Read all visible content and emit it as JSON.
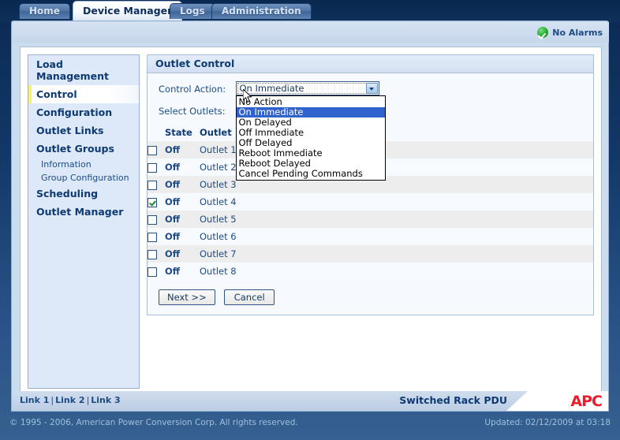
{
  "tabs": [
    {
      "label": "Home",
      "active": false
    },
    {
      "label": "Device Manager",
      "active": true
    },
    {
      "label": "Logs",
      "active": false
    },
    {
      "label": "Administration",
      "active": false
    }
  ],
  "status": {
    "alarm_text": "No Alarms",
    "alarm_icon": "green-check-icon",
    "alarm_color": "#27a833"
  },
  "sidebar": {
    "items": [
      {
        "label": "Load Management",
        "type": "heading",
        "selected": false
      },
      {
        "label": "Control",
        "type": "item",
        "selected": true
      },
      {
        "label": "Configuration",
        "type": "item",
        "selected": false
      },
      {
        "label": "Outlet Links",
        "type": "item",
        "selected": false
      },
      {
        "label": "Outlet Groups",
        "type": "item",
        "selected": false
      },
      {
        "label": "Information",
        "type": "sub",
        "selected": false
      },
      {
        "label": "Group Configuration",
        "type": "sub",
        "selected": false
      },
      {
        "label": "Scheduling",
        "type": "item",
        "selected": false
      },
      {
        "label": "Outlet Manager",
        "type": "item",
        "selected": false
      }
    ]
  },
  "panel": {
    "title": "Outlet Control",
    "control_action": {
      "label": "Control Action:",
      "value": "On Immediate",
      "expanded": true,
      "options": [
        "No Action",
        "On Immediate",
        "On Delayed",
        "Off Immediate",
        "Off Delayed",
        "Reboot Immediate",
        "Reboot Delayed",
        "Cancel Pending Commands"
      ],
      "selected_index": 1,
      "highlight_color": "#3163ce"
    },
    "select_outlets_label": "Select Outlets:",
    "table": {
      "headers": [
        "",
        "State",
        "Outlet"
      ],
      "rows": [
        {
          "checked": false,
          "state": "Off",
          "name": "Outlet 1"
        },
        {
          "checked": false,
          "state": "Off",
          "name": "Outlet 2"
        },
        {
          "checked": false,
          "state": "Off",
          "name": "Outlet 3"
        },
        {
          "checked": true,
          "state": "Off",
          "name": "Outlet 4"
        },
        {
          "checked": false,
          "state": "Off",
          "name": "Outlet 5"
        },
        {
          "checked": false,
          "state": "Off",
          "name": "Outlet 6"
        },
        {
          "checked": false,
          "state": "Off",
          "name": "Outlet 7"
        },
        {
          "checked": false,
          "state": "Off",
          "name": "Outlet 8"
        }
      ]
    },
    "buttons": {
      "next": "Next >>",
      "cancel": "Cancel"
    }
  },
  "footer": {
    "links": [
      "Link 1",
      "Link 2",
      "Link 3"
    ],
    "separator": "|",
    "product": "Switched Rack PDU",
    "logo": "APC",
    "copyright": "© 1995 - 2006, American Power Conversion Corp. All rights reserved.",
    "updated": "Updated: 02/12/2009 at 03:18"
  }
}
